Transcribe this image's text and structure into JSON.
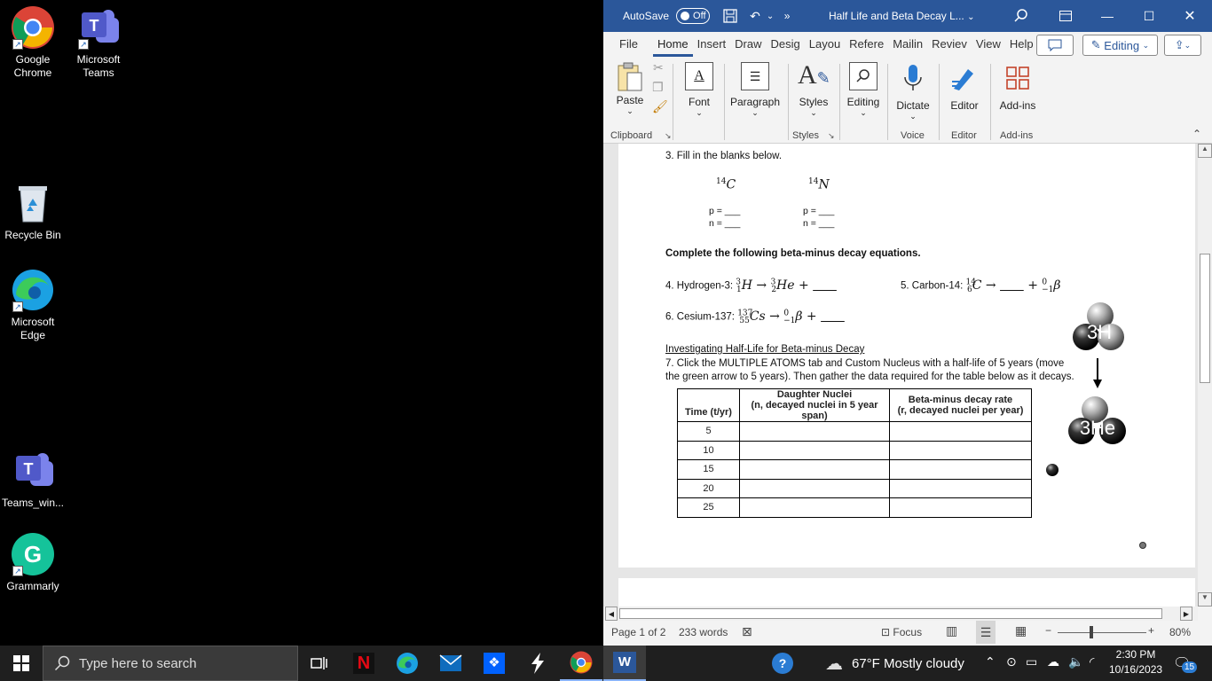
{
  "desktop": {
    "icons": [
      {
        "label": "Google Chrome"
      },
      {
        "label": "Microsoft Teams"
      },
      {
        "label": "Recycle Bin"
      },
      {
        "label": "Microsoft Edge"
      },
      {
        "label": "Teams_win..."
      },
      {
        "label": "Grammarly"
      }
    ]
  },
  "word": {
    "autosave_label": "AutoSave",
    "autosave_state": "Off",
    "title": "Half Life and Beta Decay L...",
    "tabs": [
      "File",
      "Home",
      "Insert",
      "Draw",
      "Desig",
      "Layou",
      "Refere",
      "Mailin",
      "Reviev",
      "View",
      "Help"
    ],
    "editing_mode": "Editing",
    "ribbon": {
      "paste": "Paste",
      "font": "Font",
      "paragraph": "Paragraph",
      "styles": "Styles",
      "editing": "Editing",
      "dictate": "Dictate",
      "editor": "Editor",
      "addins": "Add-ins",
      "groups": [
        "Clipboard",
        "Styles",
        "Voice",
        "Editor",
        "Add-ins"
      ]
    },
    "document": {
      "q3": "3. Fill in the blanks below.",
      "c14": "14",
      "c_sym": "C",
      "n14": "14",
      "n_sym": "N",
      "p_blank": "p = ___",
      "n_blank": "n = ___",
      "heading": "Complete the following beta-minus decay equations.",
      "q4_label": "4. Hydrogen-3: ",
      "q5_label": "5. Carbon-14: ",
      "q6_label": "6. Cesium-137: ",
      "inv_heading": "Investigating Half-Life for Beta-minus Decay",
      "q7_line1": "7. Click the MULTIPLE ATOMS tab and Custom Nucleus with a half-life of 5 years (move",
      "q7_line2": "the green arrow to 5 years).  Then gather the data required for the table below as it decays.",
      "table": {
        "headers": [
          "Time (t/yr)",
          "Daughter Nuclei",
          "(n, decayed nuclei in 5 year span)",
          "Beta-minus decay rate",
          "(r, decayed nuclei per year)"
        ],
        "rows": [
          "5",
          "10",
          "15",
          "20",
          "25"
        ]
      },
      "diagram_top": "3H",
      "diagram_bottom": "3He"
    },
    "status": {
      "page": "Page 1 of 2",
      "words": "233 words",
      "focus": "Focus",
      "zoom": "80%"
    }
  },
  "taskbar": {
    "search_placeholder": "Type here to search",
    "weather": "67°F  Mostly cloudy",
    "time": "2:30 PM",
    "date": "10/16/2023",
    "notif_count": "15"
  }
}
